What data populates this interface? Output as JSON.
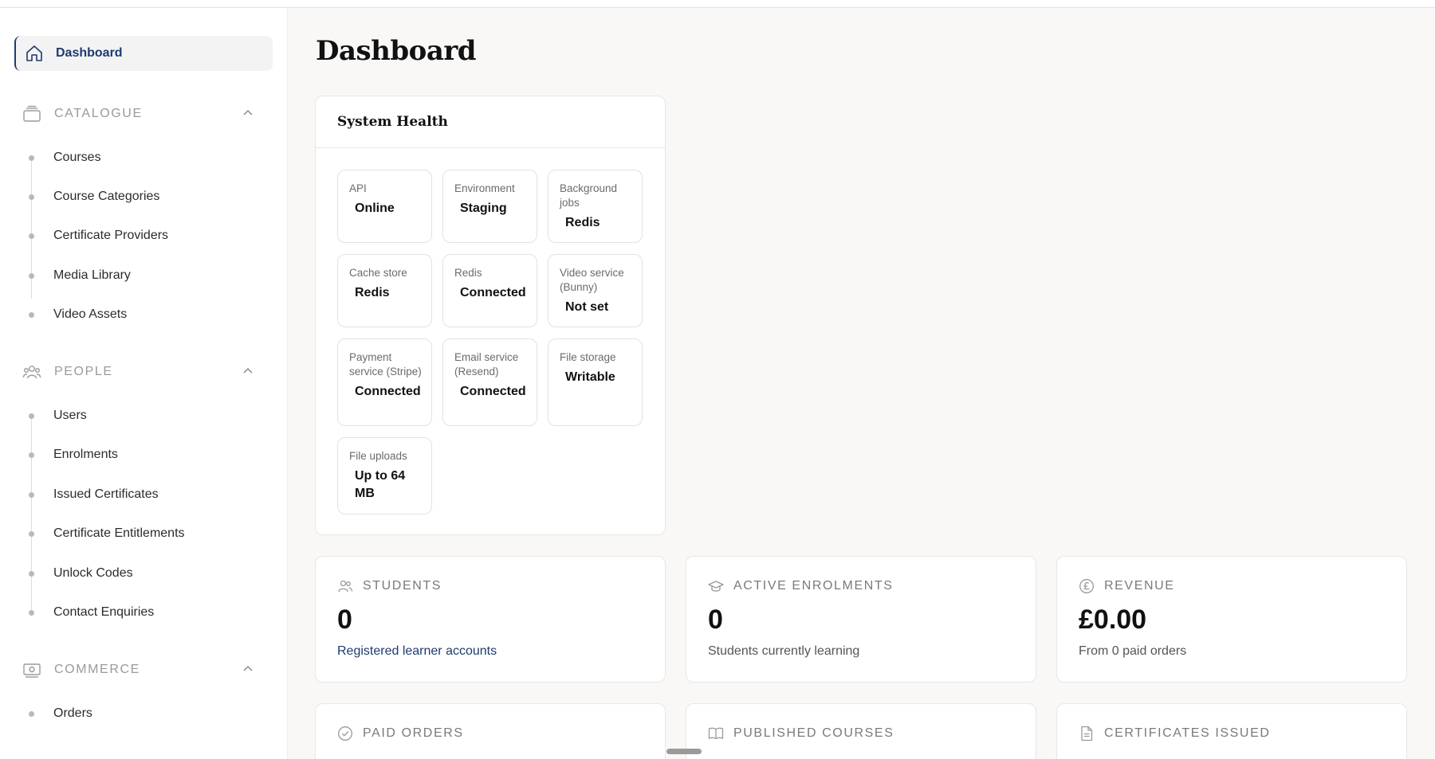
{
  "sidebar": {
    "active_item": "Dashboard",
    "sections": [
      {
        "title": "CATALOGUE",
        "items": [
          "Courses",
          "Course Categories",
          "Certificate Providers",
          "Media Library",
          "Video Assets"
        ]
      },
      {
        "title": "PEOPLE",
        "items": [
          "Users",
          "Enrolments",
          "Issued Certificates",
          "Certificate Entitlements",
          "Unlock Codes",
          "Contact Enquiries"
        ]
      },
      {
        "title": "COMMERCE",
        "items": [
          "Orders"
        ]
      }
    ]
  },
  "main": {
    "title": "Dashboard",
    "health": {
      "title": "System Health",
      "tiles": [
        {
          "label": "API",
          "value": "Online"
        },
        {
          "label": "Environment",
          "value": "Staging"
        },
        {
          "label": "Background jobs",
          "value": "Redis"
        },
        {
          "label": "Cache store",
          "value": "Redis"
        },
        {
          "label": "Redis",
          "value": "Connected"
        },
        {
          "label": "Video service (Bunny)",
          "value": "Not set"
        },
        {
          "label": "Payment service (Stripe)",
          "value": "Connected"
        },
        {
          "label": "Email service (Resend)",
          "value": "Connected"
        },
        {
          "label": "File storage",
          "value": "Writable"
        },
        {
          "label": "File uploads",
          "value": "Up to 64 MB"
        }
      ]
    },
    "stats": [
      {
        "label": "STUDENTS",
        "icon": "users-icon",
        "value": "0",
        "sub": "Registered learner accounts"
      },
      {
        "label": "ACTIVE ENROLMENTS",
        "icon": "graduation-cap-icon",
        "value": "0",
        "sub": "Students currently learning"
      },
      {
        "label": "REVENUE",
        "icon": "pound-icon",
        "value": "£0.00",
        "sub": "From 0 paid orders"
      },
      {
        "label": "PAID ORDERS",
        "icon": "check-circle-icon"
      },
      {
        "label": "PUBLISHED COURSES",
        "icon": "book-icon"
      },
      {
        "label": "CERTIFICATES ISSUED",
        "icon": "document-icon"
      }
    ]
  },
  "colors": {
    "accent": "#1e3a6e",
    "background": "#f9f8f7"
  }
}
